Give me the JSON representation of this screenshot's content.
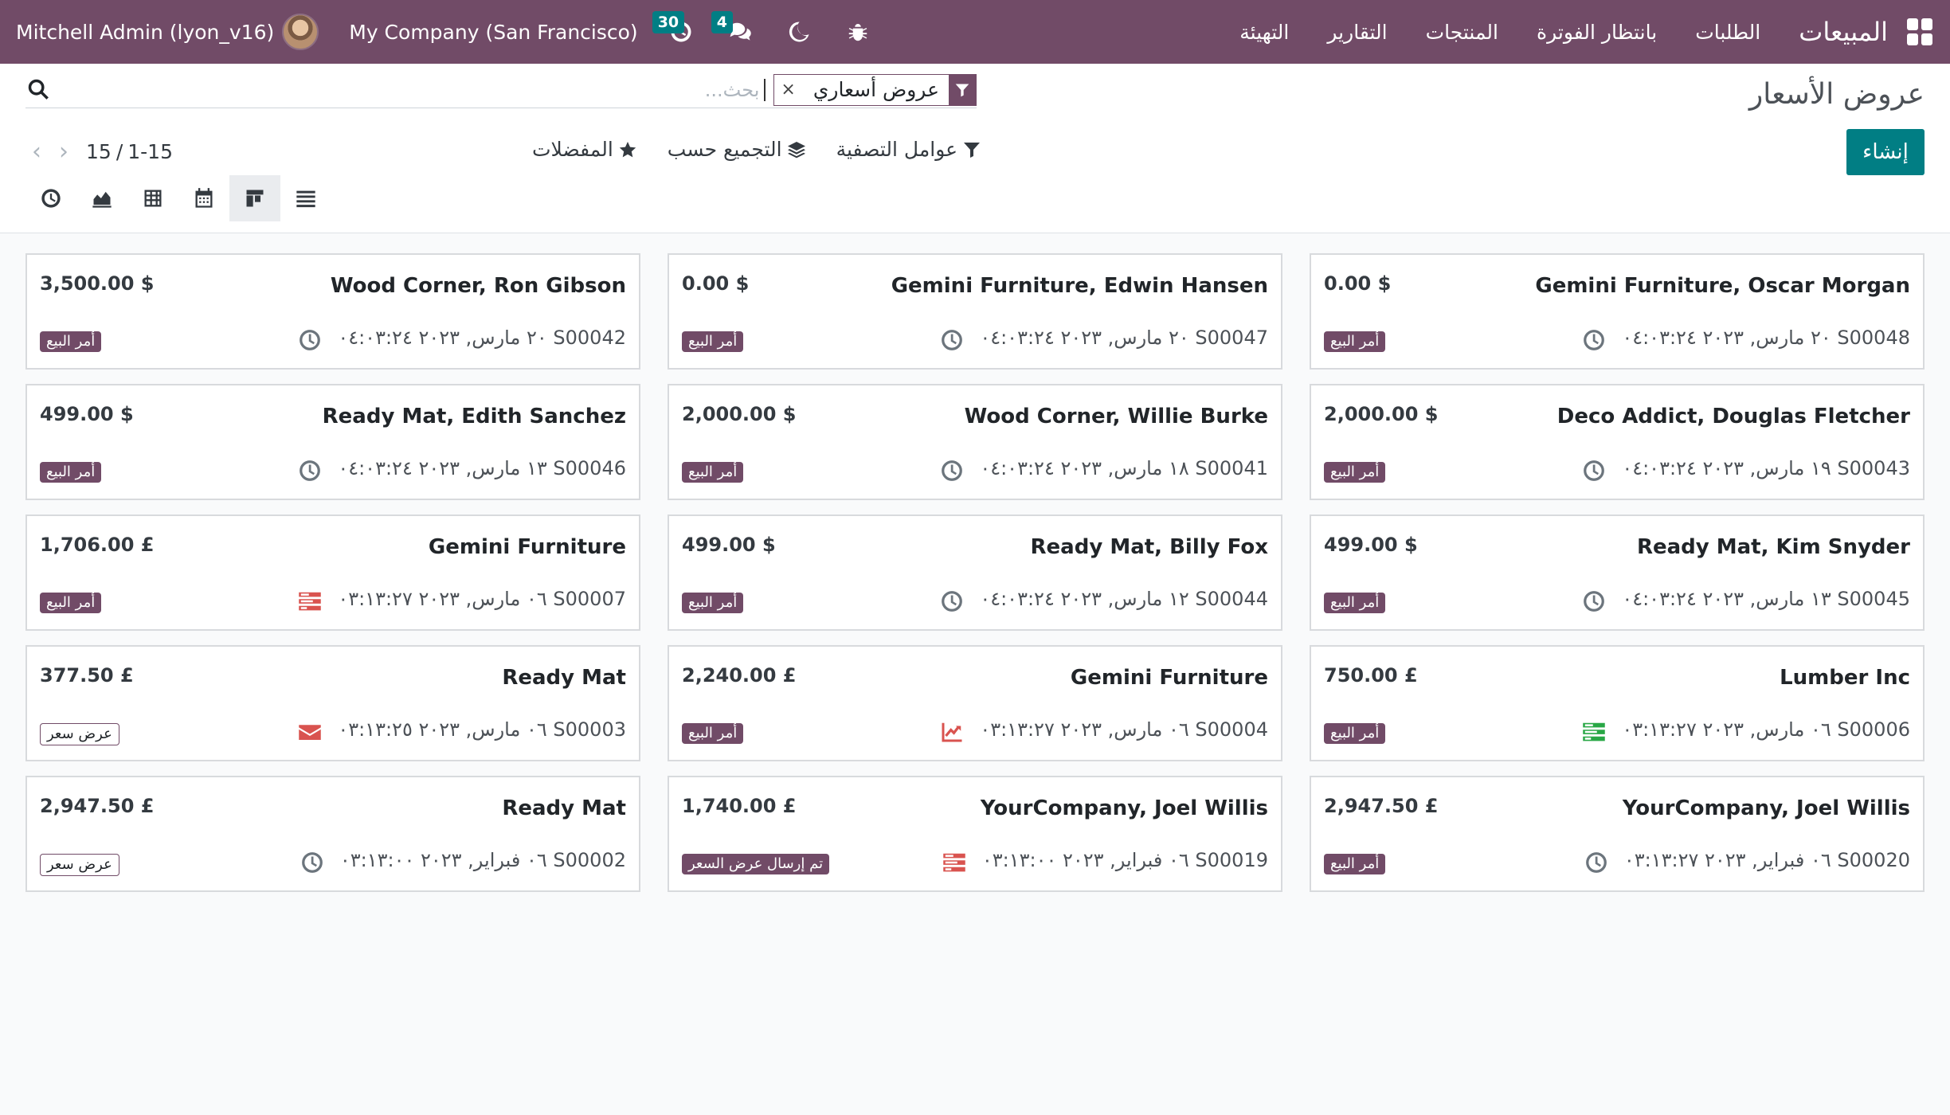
{
  "navbar": {
    "user": "Mitchell Admin (lyon_v16)",
    "company": "My Company (San Francisco)",
    "activity_count": "30",
    "message_count": "4",
    "brand": "المبيعات",
    "menu": [
      "الطلبات",
      "بانتظار الفوترة",
      "المنتجات",
      "التقارير",
      "التهيئة"
    ],
    "colors": {
      "primary": "#714b67",
      "accent": "#017e84"
    }
  },
  "control": {
    "title": "عروض الأسعار",
    "facet": "عروض أسعاري",
    "search_placeholder": "بحث...",
    "create": "إنشاء",
    "filters": "عوامل التصفية",
    "groupby": "التجميع حسب",
    "favorites": "المفضلات",
    "pager_value": "1-15",
    "pager_total": "15",
    "pager_separator": "/"
  },
  "cards": [
    {
      "name": "Gemini Furniture, Oscar Morgan",
      "amount": "0.00 $",
      "ref": "S00048 ٢٠ مارس, ٢٠٢٣ ٠٤:٠٣:٢٤",
      "status": "أمر البيع",
      "status_type": "sale",
      "activity": "clock-icon"
    },
    {
      "name": "Gemini Furniture, Edwin Hansen",
      "amount": "0.00 $",
      "ref": "S00047 ٢٠ مارس, ٢٠٢٣ ٠٤:٠٣:٢٤",
      "status": "أمر البيع",
      "status_type": "sale",
      "activity": "clock-icon"
    },
    {
      "name": "Wood Corner, Ron Gibson",
      "amount": "3,500.00 $",
      "ref": "S00042 ٢٠ مارس, ٢٠٢٣ ٠٤:٠٣:٢٤",
      "status": "أمر البيع",
      "status_type": "sale",
      "activity": "clock-icon"
    },
    {
      "name": "Deco Addict, Douglas Fletcher",
      "amount": "2,000.00 $",
      "ref": "S00043 ١٩ مارس, ٢٠٢٣ ٠٤:٠٣:٢٤",
      "status": "أمر البيع",
      "status_type": "sale",
      "activity": "clock-icon"
    },
    {
      "name": "Wood Corner, Willie Burke",
      "amount": "2,000.00 $",
      "ref": "S00041 ١٨ مارس, ٢٠٢٣ ٠٤:٠٣:٢٤",
      "status": "أمر البيع",
      "status_type": "sale",
      "activity": "clock-icon"
    },
    {
      "name": "Ready Mat, Edith Sanchez",
      "amount": "499.00 $",
      "ref": "S00046 ١٣ مارس, ٢٠٢٣ ٠٤:٠٣:٢٤",
      "status": "أمر البيع",
      "status_type": "sale",
      "activity": "clock-icon"
    },
    {
      "name": "Ready Mat, Kim Snyder",
      "amount": "499.00 $",
      "ref": "S00045 ١٣ مارس, ٢٠٢٣ ٠٤:٠٣:٢٤",
      "status": "أمر البيع",
      "status_type": "sale",
      "activity": "clock-icon"
    },
    {
      "name": "Ready Mat, Billy Fox",
      "amount": "499.00 $",
      "ref": "S00044 ١٢ مارس, ٢٠٢٣ ٠٤:٠٣:٢٤",
      "status": "أمر البيع",
      "status_type": "sale",
      "activity": "clock-icon"
    },
    {
      "name": "Gemini Furniture",
      "amount": "1,706.00 £",
      "ref": "S00007 ٠٦ مارس, ٢٠٢٣ ٠٣:١٣:٢٧",
      "status": "أمر البيع",
      "status_type": "sale",
      "activity": "tasks-red-icon"
    },
    {
      "name": "Lumber Inc",
      "amount": "750.00 £",
      "ref": "S00006 ٠٦ مارس, ٢٠٢٣ ٠٣:١٣:٢٧",
      "status": "أمر البيع",
      "status_type": "sale",
      "activity": "tasks-green-icon"
    },
    {
      "name": "Gemini Furniture",
      "amount": "2,240.00 £",
      "ref": "S00004 ٠٦ مارس, ٢٠٢٣ ٠٣:١٣:٢٧",
      "status": "أمر البيع",
      "status_type": "sale",
      "activity": "chart-red-icon"
    },
    {
      "name": "Ready Mat",
      "amount": "377.50 £",
      "ref": "S00003 ٠٦ مارس, ٢٠٢٣ ٠٣:١٣:٢٥",
      "status": "عرض سعر",
      "status_type": "draft",
      "activity": "envelope-red-icon"
    },
    {
      "name": "YourCompany, Joel Willis",
      "amount": "2,947.50 £",
      "ref": "S00020 ٠٦ فبراير, ٢٠٢٣ ٠٣:١٣:٢٧",
      "status": "أمر البيع",
      "status_type": "sale",
      "activity": "clock-icon"
    },
    {
      "name": "YourCompany, Joel Willis",
      "amount": "1,740.00 £",
      "ref": "S00019 ٠٦ فبراير, ٢٠٢٣ ٠٣:١٣:٠٠",
      "status": "تم إرسال عرض السعر",
      "status_type": "sent",
      "activity": "tasks-red-icon"
    },
    {
      "name": "Ready Mat",
      "amount": "2,947.50 £",
      "ref": "S00002 ٠٦ فبراير, ٢٠٢٣ ٠٣:١٣:٠٠",
      "status": "عرض سعر",
      "status_type": "draft",
      "activity": "clock-icon"
    }
  ]
}
